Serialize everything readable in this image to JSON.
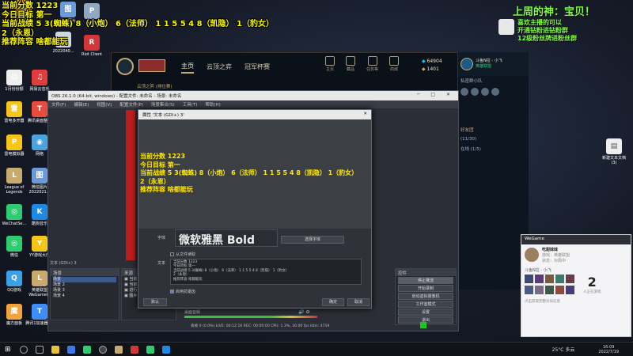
{
  "overlay": {
    "lines": [
      "当前分数 1223",
      "今日目标 第一",
      "当前战绩 5 3(蜘蛛) 8（小炮） 6（法师） 1 1 5 5 4 8（凯隐） 1（豹女）",
      "2（永恩）",
      "推荐阵容 啥都能玩"
    ],
    "right_title": "上周的神：宝贝！",
    "right_lines": [
      "喜欢主播的可以",
      "开通钻粉进钻粉群",
      "12级粉丝牌进粉丝群"
    ]
  },
  "desktop_icons": [
    {
      "label": "当前分数",
      "color": "#f5a623",
      "glyph": "当"
    },
    {
      "label": "微信图片",
      "color": "#6a9bd8",
      "glyph": "图"
    },
    {
      "label": "PRE",
      "color": "#8fa9c2",
      "glyph": "P"
    },
    {
      "label": "2022040...",
      "color": "#cfd8e0",
      "glyph": "▤"
    },
    {
      "label": "Riot Client",
      "color": "#d13639",
      "glyph": "R"
    },
    {
      "label": "1月份份额",
      "color": "#eeeeee",
      "glyph": "▤"
    },
    {
      "label": "网易云音乐",
      "color": "#e23d3d",
      "glyph": "♫"
    },
    {
      "label": "雷电多开器",
      "color": "#f5c518",
      "glyph": "雷"
    },
    {
      "label": "腾讯桌面整理",
      "color": "#e84c3d",
      "glyph": "T"
    },
    {
      "label": "雷电模拟器",
      "color": "#f5c518",
      "glyph": "P"
    },
    {
      "label": "网络",
      "color": "#4aa3df",
      "glyph": "◉"
    },
    {
      "label": "League of Legends",
      "color": "#c8aa6e",
      "glyph": "L"
    },
    {
      "label": "微信图片2022021...",
      "color": "#6a9bd8",
      "glyph": "图"
    },
    {
      "label": "WeChatSe...",
      "color": "#2ecc71",
      "glyph": "◎"
    },
    {
      "label": "酷狗音乐",
      "color": "#1e88e5",
      "glyph": "K"
    },
    {
      "label": "微信",
      "color": "#2ecc71",
      "glyph": "◎"
    },
    {
      "label": "YY游戏大厅",
      "color": "#f5c518",
      "glyph": "Y"
    },
    {
      "label": "QQ游戏",
      "color": "#3aa0e8",
      "glyph": "Q"
    },
    {
      "label": "英雄联盟WeGame版",
      "color": "#c8aa6e",
      "glyph": "L"
    },
    {
      "label": "腾讯会议",
      "color": "#2f7de1",
      "glyph": "会"
    },
    {
      "label": "魔方面板",
      "color": "#f2a33a",
      "glyph": "魔"
    },
    {
      "label": "腾讯1加速器(1)",
      "color": "#3d8ef8",
      "glyph": "T"
    },
    {
      "label": "360软件管家",
      "color": "#3d6ad8",
      "glyph": "3"
    }
  ],
  "right_desktop_icon": {
    "label": "新建文本文档(3)",
    "glyph": "▤"
  },
  "lol": {
    "nav": [
      "主页",
      "云顶之弈",
      "冠军杯赛"
    ],
    "currency_be": "64904",
    "currency_rp": "1401",
    "side_icons": [
      "主页",
      "藏品",
      "任务等",
      "商城"
    ],
    "tab": "云顶之弈 (排位赛)"
  },
  "obs": {
    "title": "OBS 26.1.0 (64-bit, windows) - 配置文件: 未命名 - 场景: 未命名",
    "menu": [
      "文件(F)",
      "编辑(E)",
      "视图(V)",
      "配置文件(P)",
      "场景集合(S)",
      "工具(T)",
      "帮助(H)"
    ],
    "scenes_header": "场景",
    "scenes": [
      "场景",
      "场景 2",
      "场景 3",
      "场景 4"
    ],
    "sources_header": "来源",
    "sources": [
      "当前",
      "当前",
      "进行",
      "图片"
    ],
    "mixer_label": "桌面音频",
    "controls_header": "控件",
    "controls": [
      "停止推流",
      "开始录制",
      "启动虚拟摄像机",
      "工作室模式",
      "设置",
      "退出"
    ],
    "status": "丢帧 0 (0.0%)    LIVE: 00:12:16    REC: 00:00:00    CPU: 1.3%, 30.00 fps    kb/s: 4719",
    "text_source_label": "文本 (GDI+) 3"
  },
  "dialog": {
    "title": "属性 '文本 (GDI+) 3'",
    "close_glyph": "✕",
    "preview_lines": [
      "当前分数 1223",
      "今日目标 第一",
      "当前战绩 5 3(蜘蛛) 8（小炮） 6（法师） 1 1 5 5 4 8（凯隐） 1（豹女）",
      "2（永恩）",
      "推荐阵容 啥都能玩"
    ],
    "font_label": "字体",
    "font_value": "微软雅黑 Bold",
    "choose_font": "选择字体",
    "from_file": "从文件读取",
    "text_label": "文本",
    "text_lines": [
      "当前分数 1223",
      "今日目标 第一",
      "当前战绩 5 3(蜘蛛) 8（小炮） 6（法师） 1 1 5 5 4 8（凯隐） 1（豹女）",
      "2（永恩）",
      "推荐阵容 啥都能玩"
    ],
    "antialias": "启用抗锯齿",
    "defaults": "默认",
    "ok": "确定",
    "cancel": "取消"
  },
  "chat": {
    "user": "斗鱼N拉 - 小飞",
    "status": "英雄联盟",
    "group": "私密群小队",
    "section": "好友团",
    "section_count": "(11/30)",
    "items": [
      "在线 (1/5)",
      "",
      "",
      "",
      ""
    ]
  },
  "game_card": {
    "header": "WeGame",
    "name": "吃甜妹妹",
    "line1": "游戏：英雄联盟",
    "line2": "状态：对局中",
    "team_label": "斗鱼N拉 - 小飞",
    "count": "2",
    "count_label": "人正在游戏",
    "footer": "点击获取完整对局信息"
  },
  "taskbar": {
    "weather": "25°C 多云",
    "time": "16:09",
    "date": "2022/7/19"
  }
}
